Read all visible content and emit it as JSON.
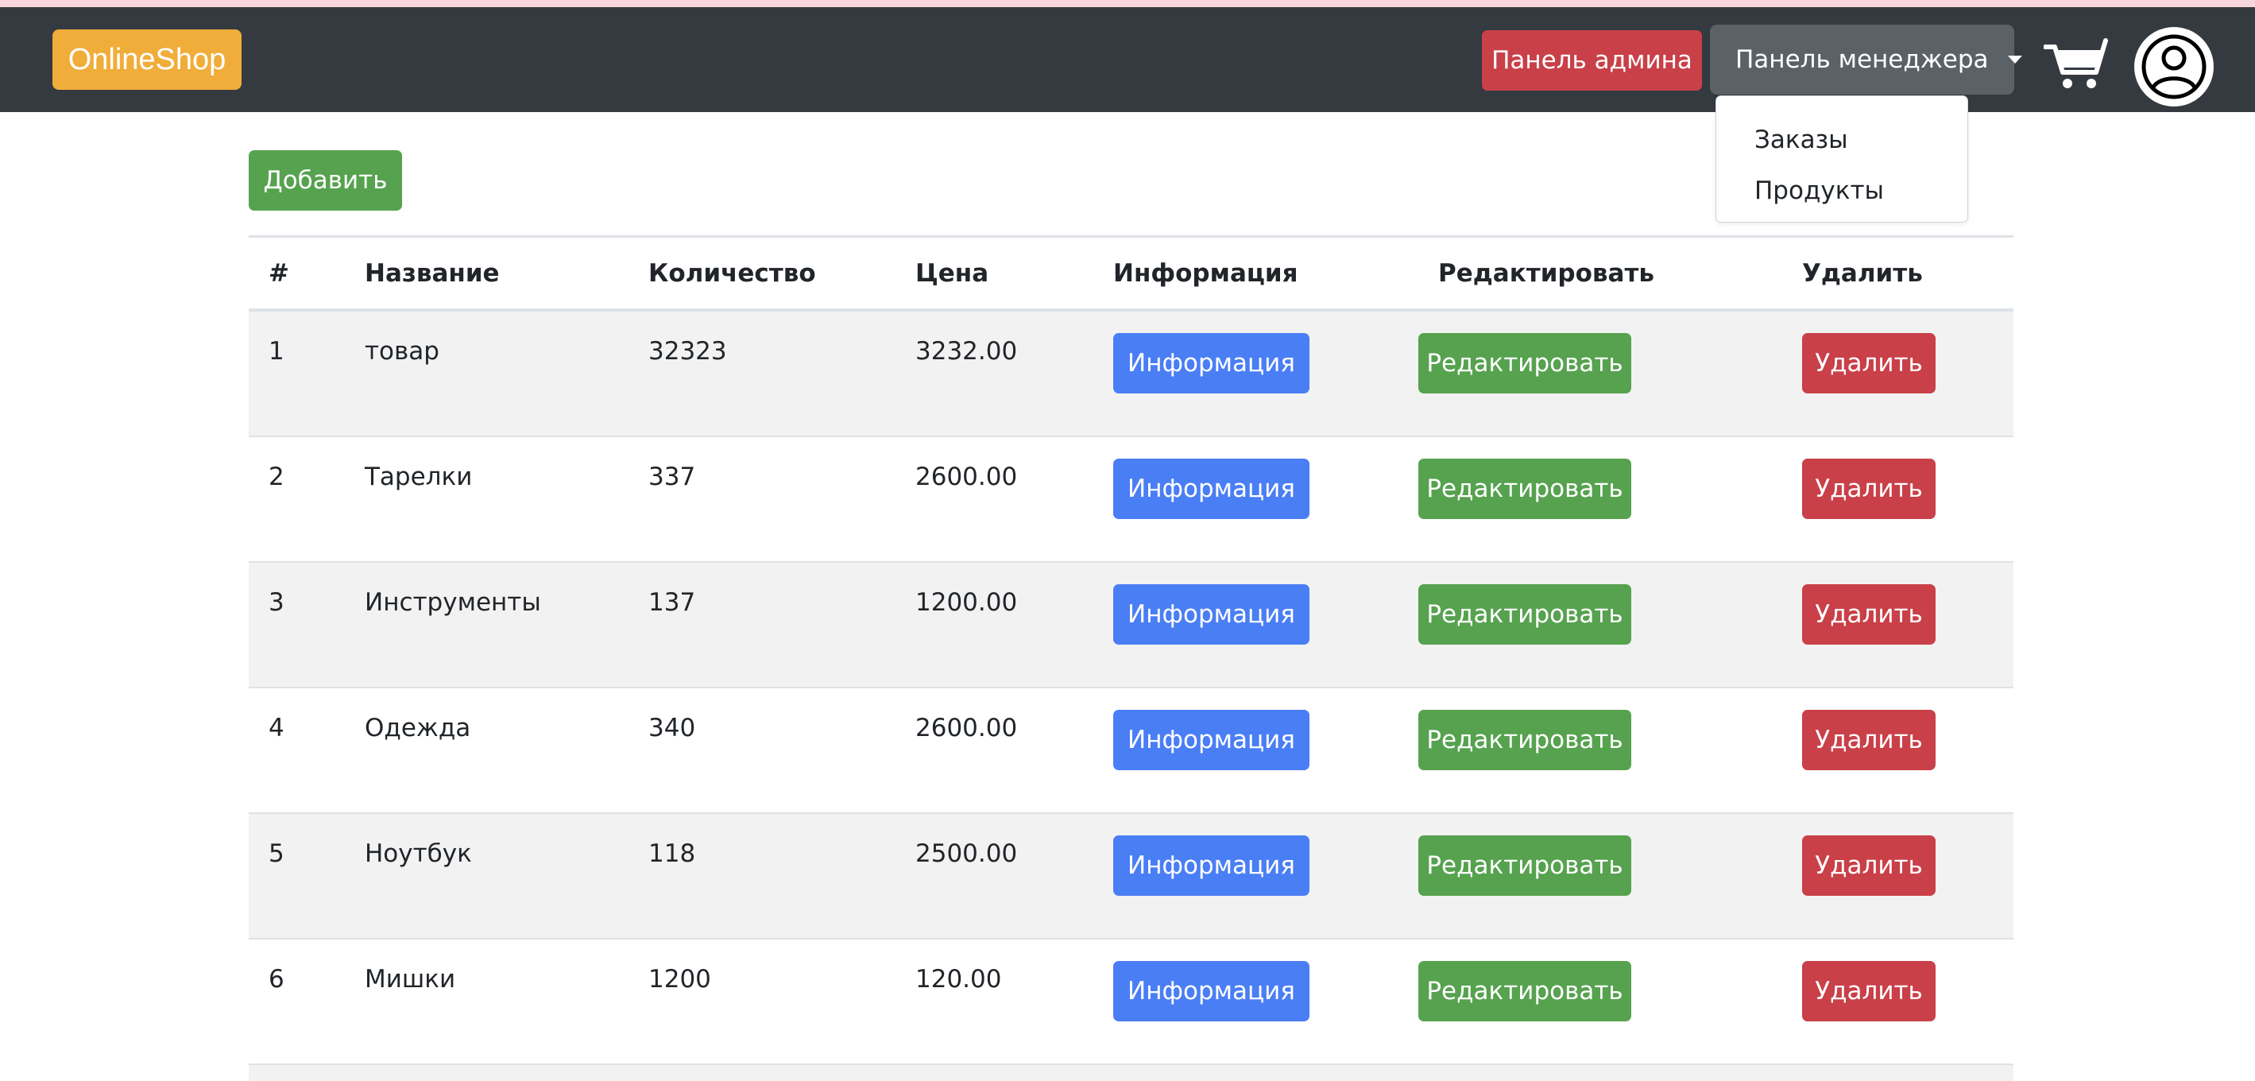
{
  "navbar": {
    "brand": "OnlineShop",
    "admin_panel": "Панель админа",
    "manager_panel": "Панель менеджера",
    "cart_icon": "cart-icon",
    "user_icon": "user-circle-icon"
  },
  "dropdown": {
    "items": [
      "Заказы",
      "Продукты"
    ]
  },
  "toolbar": {
    "add_label": "Добавить"
  },
  "table": {
    "headers": [
      "#",
      "Название",
      "Количество",
      "Цена",
      "Информация",
      "Редактировать",
      "Удалить"
    ],
    "rows": [
      {
        "id": "1",
        "name": "товар",
        "qty": "32323",
        "price": "3232.00"
      },
      {
        "id": "2",
        "name": "Тарелки",
        "qty": "337",
        "price": "2600.00"
      },
      {
        "id": "3",
        "name": "Инструменты",
        "qty": "137",
        "price": "1200.00"
      },
      {
        "id": "4",
        "name": "Одежда",
        "qty": "340",
        "price": "2600.00"
      },
      {
        "id": "5",
        "name": "Ноутбук",
        "qty": "118",
        "price": "2500.00"
      },
      {
        "id": "6",
        "name": "Мишки",
        "qty": "1200",
        "price": "120.00"
      }
    ],
    "info_label": "Информация",
    "edit_label": "Редактировать",
    "delete_label": "Удалить"
  },
  "colors": {
    "navbar_bg": "#343a40",
    "brand_bg": "#f0ad3a",
    "danger": "#c94048",
    "success": "#56a24f",
    "primary": "#4a7ef5",
    "secondary": "#5a6268"
  }
}
